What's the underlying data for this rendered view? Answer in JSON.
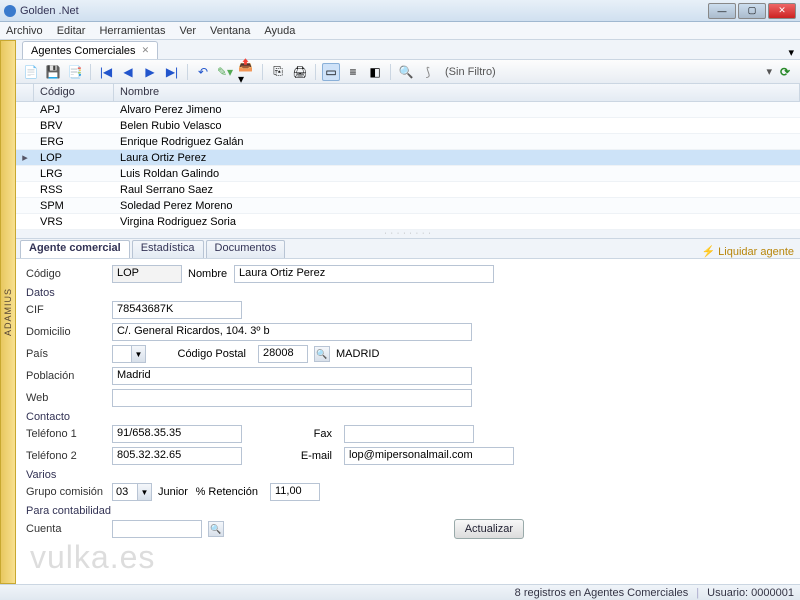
{
  "app": {
    "title": "Golden .Net"
  },
  "menus": [
    "Archivo",
    "Editar",
    "Herramientas",
    "Ver",
    "Ventana",
    "Ayuda"
  ],
  "side_tab": "ADAMIUS",
  "doc_tab": {
    "label": "Agentes Comerciales"
  },
  "toolbar": {
    "filter_label": "(Sin Filtro)"
  },
  "grid": {
    "headers": {
      "codigo": "Código",
      "nombre": "Nombre"
    },
    "rows": [
      {
        "codigo": "APJ",
        "nombre": "Alvaro Perez Jimeno"
      },
      {
        "codigo": "BRV",
        "nombre": "Belen Rubio Velasco"
      },
      {
        "codigo": "ERG",
        "nombre": "Enrique Rodriguez Galán"
      },
      {
        "codigo": "LOP",
        "nombre": "Laura Ortiz Perez"
      },
      {
        "codigo": "LRG",
        "nombre": "Luis Roldan Galindo"
      },
      {
        "codigo": "RSS",
        "nombre": "Raul Serrano Saez"
      },
      {
        "codigo": "SPM",
        "nombre": "Soledad Perez Moreno"
      },
      {
        "codigo": "VRS",
        "nombre": "Virgina Rodriguez Soria"
      }
    ],
    "selected_index": 3
  },
  "detail_tabs": [
    "Agente comercial",
    "Estadística",
    "Documentos"
  ],
  "liquidar_label": "Liquidar agente",
  "form": {
    "labels": {
      "codigo": "Código",
      "nombre": "Nombre",
      "datos": "Datos",
      "cif": "CIF",
      "domicilio": "Domicilio",
      "pais": "País",
      "cp": "Código Postal",
      "poblacion": "Población",
      "web": "Web",
      "contacto": "Contacto",
      "tel1": "Teléfono 1",
      "tel2": "Teléfono 2",
      "fax": "Fax",
      "email": "E-mail",
      "varios": "Varios",
      "grupo": "Grupo comisión",
      "retencion": "% Retención",
      "paracont": "Para contabilidad",
      "cuenta": "Cuenta",
      "actualizar": "Actualizar"
    },
    "values": {
      "codigo": "LOP",
      "nombre": "Laura Ortiz Perez",
      "cif": "78543687K",
      "domicilio": "C/. General Ricardos, 104. 3º b",
      "pais": "",
      "cp": "28008",
      "cp_ciudad": "MADRID",
      "poblacion": "Madrid",
      "web": "",
      "tel1": "91/658.35.35",
      "tel2": "805.32.32.65",
      "fax": "",
      "email": "lop@mipersonalmail.com",
      "grupo": "03",
      "grupo_desc": "Junior",
      "retencion": "11,00",
      "cuenta": ""
    }
  },
  "status": {
    "records": "8 registros en Agentes Comerciales",
    "user": "Usuario: 0000001"
  },
  "watermark": "vulka.es"
}
